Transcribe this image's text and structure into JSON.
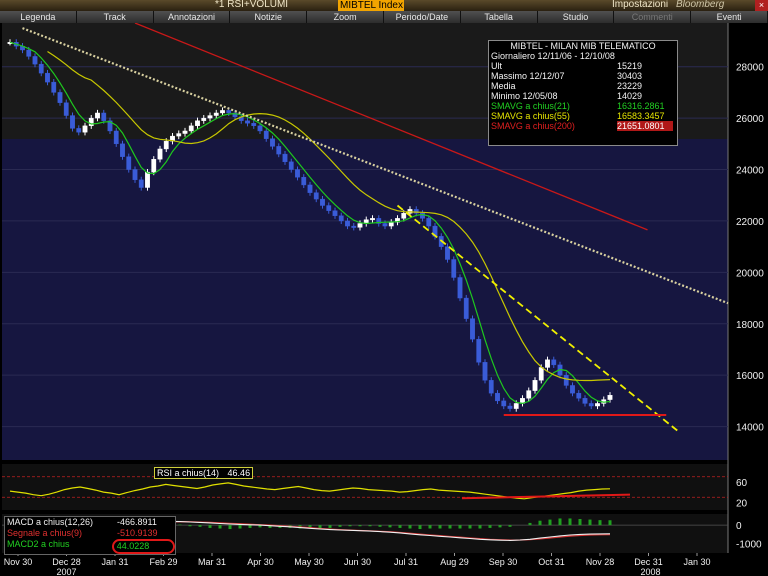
{
  "window": {
    "title": "*1 RSI+VOLUMI",
    "ticker": "MIBTEL Index",
    "settings_label": "Impostazioni",
    "brand": "Bloomberg",
    "close_glyph": "×"
  },
  "menu": [
    "Legenda",
    "Track",
    "Annotazioni",
    "Notizie",
    "Zoom",
    "Periodo/Date",
    "Tabella",
    "Studio",
    "Commenti",
    "Eventi"
  ],
  "menu_disabled": [
    "Commenti"
  ],
  "legend": {
    "title": "MIBTEL - MILAN MIB TELEMATICO",
    "rows": [
      {
        "label": "Giornaliero 12/11/06 - 12/10/08",
        "value": "",
        "color": "#f4f4f4"
      },
      {
        "label": "Ult",
        "value": "15219",
        "color": "#f4f4f4"
      },
      {
        "label": "Massimo  12/12/07",
        "value": "30403",
        "color": "#f4f4f4"
      },
      {
        "label": "Media",
        "value": "23229",
        "color": "#f4f4f4"
      },
      {
        "label": "Minimo  12/05/08",
        "value": "14029",
        "color": "#f4f4f4"
      },
      {
        "label": "SMAVG a chius(21)",
        "value": "16316.2861",
        "color": "#22d022"
      },
      {
        "label": "SMAVG a chius(55)",
        "value": "16583.3457",
        "color": "#e6e600"
      },
      {
        "label": "SMAVG a chius(200)",
        "value": "21651.0801",
        "color": "#e02020",
        "valbg": "#b01818"
      }
    ]
  },
  "rsi_label": {
    "text": "RSI a chius(14)",
    "value": "46.46"
  },
  "macd_legend": [
    {
      "label": "MACD a chius(12,26)",
      "value": "-466.8911",
      "color": "#f0f0f0"
    },
    {
      "label": "Segnale a chius(9)",
      "value": "-510.9139",
      "color": "#e03030"
    },
    {
      "label": "MACD2 a chius",
      "value": "44.0228",
      "color": "#22d022"
    }
  ],
  "colors": {
    "bg_top": "#141414",
    "bg_upper": "#1a1a1a",
    "bg_main": "#161640",
    "candle_up": "#ffffff",
    "candle_down": "#3a5cd8",
    "sma21": "#1ec81e",
    "sma55": "#c8c800",
    "sma200": "#c81818",
    "trend_dotted": "#d8d0a0",
    "trend_dashed": "#f0f000",
    "support": "#e01818",
    "rsi_line": "#e0e000",
    "macd_line": "#f0f0f0",
    "signal_line": "#d03030",
    "hist": "#20a020",
    "axis_text": "#f0f0f0"
  },
  "chart_data": {
    "type": "candlestick",
    "price_axis": {
      "ylim": [
        12700,
        29700
      ],
      "ticks": [
        14000,
        16000,
        18000,
        20000,
        22000,
        24000,
        26000,
        28000
      ]
    },
    "rsi_axis": {
      "ylim": [
        5,
        95
      ],
      "ticks": [
        20,
        60
      ],
      "levels": [
        30,
        70
      ],
      "current": 46.46
    },
    "macd_axis": {
      "ylim": [
        -1500,
        600
      ],
      "ticks": [
        -1000,
        0
      ]
    },
    "x_labels": [
      "Nov 30",
      "Dec 28",
      "Jan 31",
      "Feb 29",
      "Mar 31",
      "Apr 30",
      "May 30",
      "Jun 30",
      "Jul 31",
      "Aug 29",
      "Sep 30",
      "Oct 31",
      "Nov 28",
      "Dec 31",
      "Jan 30"
    ],
    "year_labels": [
      {
        "text": "2007",
        "at": "Dec 28"
      },
      {
        "text": "2008",
        "at": "Jan 30"
      }
    ],
    "closes": [
      28950,
      28800,
      28650,
      28400,
      28100,
      27750,
      27400,
      27000,
      26600,
      26100,
      25600,
      25450,
      25700,
      26000,
      26200,
      25900,
      25500,
      25000,
      24500,
      24000,
      23600,
      23300,
      23900,
      24400,
      24800,
      25100,
      25300,
      25400,
      25500,
      25700,
      25900,
      26000,
      26100,
      26200,
      26300,
      26200,
      26050,
      25900,
      25800,
      25700,
      25500,
      25200,
      24900,
      24600,
      24300,
      24000,
      23700,
      23400,
      23100,
      22850,
      22600,
      22400,
      22200,
      22000,
      21800,
      21750,
      21900,
      22050,
      22100,
      21900,
      21800,
      21950,
      22100,
      22300,
      22450,
      22300,
      22100,
      21800,
      21400,
      21000,
      20500,
      19800,
      19000,
      18200,
      17400,
      16500,
      15800,
      15300,
      15000,
      14800,
      14700,
      14900,
      15100,
      15400,
      15800,
      16300,
      16600,
      16400,
      16000,
      15600,
      15300,
      15100,
      14900,
      14800,
      14900,
      15050,
      15219
    ],
    "sma21_end": 16316.2861,
    "sma55_end": 16583.3457,
    "sma200_end": 21651.0801,
    "support_level": 14450,
    "rsi_values": [
      42,
      40,
      38,
      35,
      33,
      36,
      40,
      45,
      48,
      50,
      47,
      44,
      40,
      38,
      35,
      39,
      43,
      46,
      50,
      52,
      55,
      53,
      51,
      49,
      47,
      50,
      54,
      56,
      58,
      55,
      52,
      50,
      48,
      46,
      45,
      47,
      49,
      51,
      48,
      45,
      43,
      42,
      44,
      46,
      48,
      47,
      45,
      44,
      43,
      42,
      40,
      41,
      43,
      45,
      46,
      44,
      43,
      42,
      41,
      40,
      38,
      36,
      34,
      32,
      30,
      28,
      27,
      29,
      31,
      33,
      35,
      37,
      39,
      42,
      44,
      45,
      46,
      46.46
    ],
    "macd_values": [
      -50,
      -120,
      -200,
      -260,
      -300,
      -320,
      -280,
      -220,
      -150,
      -80,
      -20,
      40,
      90,
      130,
      160,
      180,
      200,
      190,
      170,
      150,
      120,
      90,
      60,
      40,
      20,
      0,
      -30,
      -60,
      -90,
      -130,
      -170,
      -210,
      -240,
      -260,
      -280,
      -300,
      -320,
      -350,
      -380,
      -420,
      -470,
      -520,
      -560,
      -600,
      -640,
      -680,
      -720,
      -760,
      -790,
      -810,
      -820,
      -800,
      -760,
      -700,
      -640,
      -580,
      -530,
      -500,
      -480,
      -470,
      -466.8911
    ],
    "signal_values": [
      -40,
      -90,
      -150,
      -210,
      -250,
      -280,
      -270,
      -240,
      -190,
      -130,
      -70,
      -10,
      40,
      90,
      130,
      160,
      180,
      185,
      180,
      165,
      145,
      120,
      95,
      70,
      45,
      20,
      -5,
      -35,
      -65,
      -100,
      -140,
      -180,
      -215,
      -245,
      -270,
      -290,
      -310,
      -335,
      -360,
      -395,
      -440,
      -485,
      -530,
      -570,
      -610,
      -650,
      -690,
      -730,
      -765,
      -790,
      -805,
      -800,
      -780,
      -740,
      -690,
      -640,
      -590,
      -555,
      -530,
      -515,
      -510.9139
    ]
  }
}
